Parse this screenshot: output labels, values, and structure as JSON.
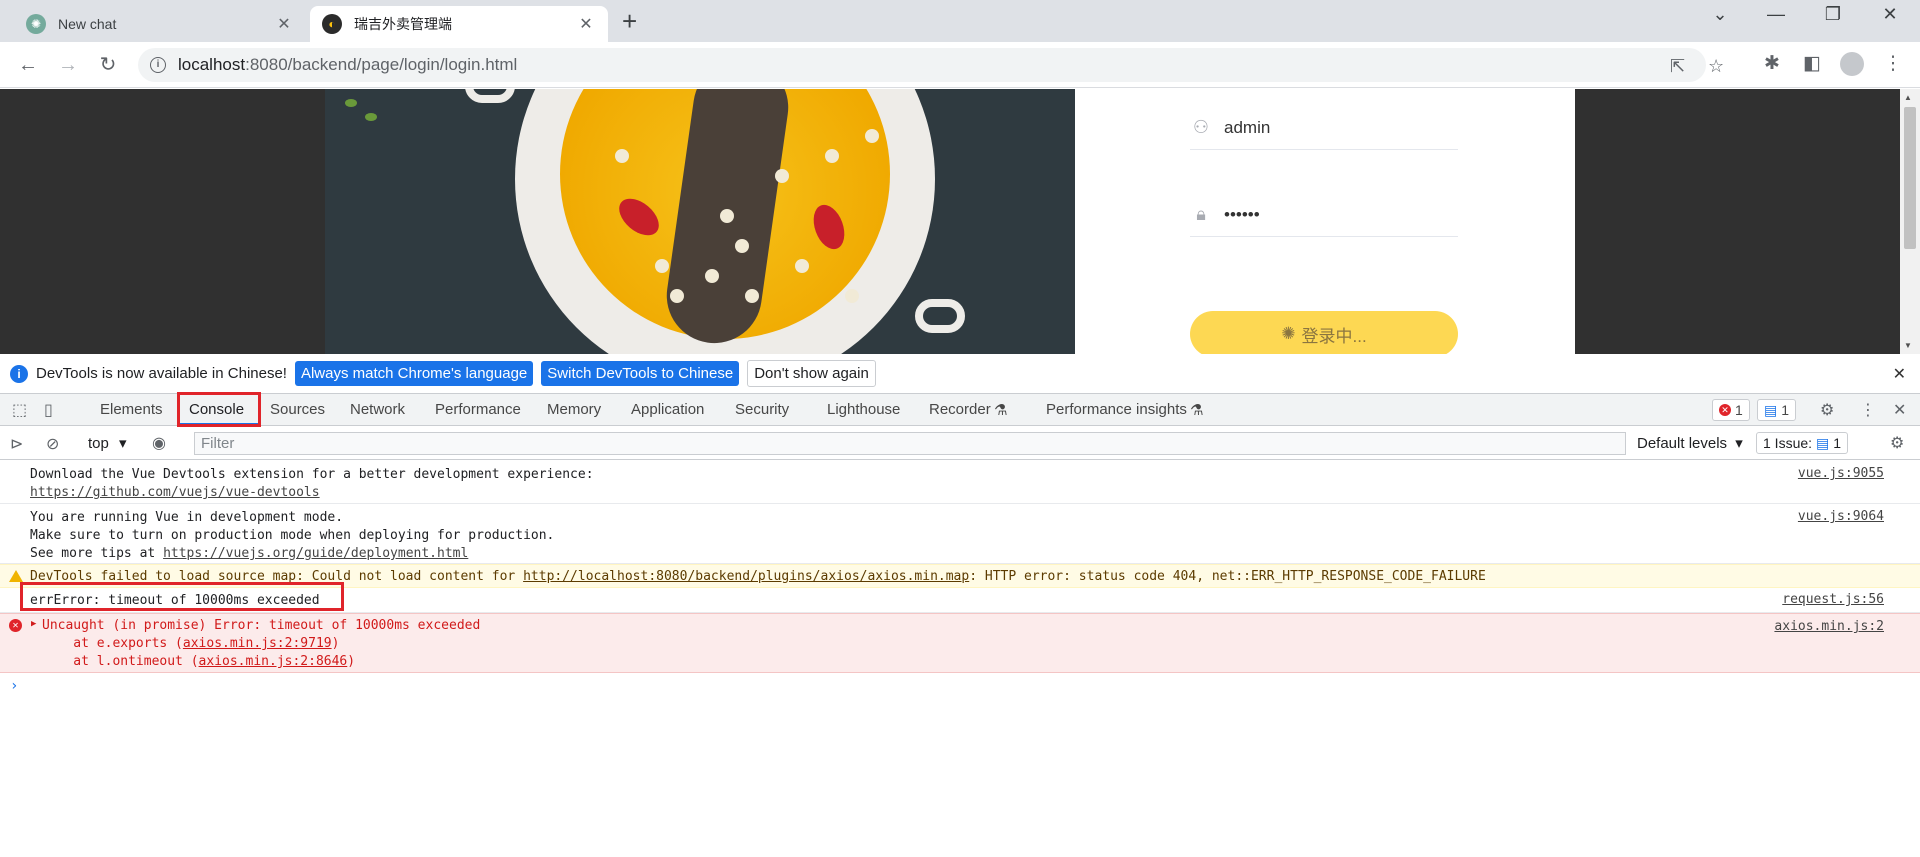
{
  "browser": {
    "tabs": [
      {
        "title": "New chat",
        "favicon": "chatgpt-icon"
      },
      {
        "title": "瑞吉外卖管理端",
        "favicon": "site-logo-icon"
      }
    ],
    "new_tab_symbol": "+",
    "url_host": "localhost",
    "url_path": ":8080/backend/page/login/login.html"
  },
  "login": {
    "username": "admin",
    "password": "••••••",
    "button_label": "登录中..."
  },
  "devtools": {
    "infobar": {
      "message": "DevTools is now available in Chinese!",
      "btn_match": "Always match Chrome's language",
      "btn_switch": "Switch DevTools to Chinese",
      "btn_dismiss": "Don't show again"
    },
    "tabs": [
      "Elements",
      "Console",
      "Sources",
      "Network",
      "Performance",
      "Memory",
      "Application",
      "Security",
      "Lighthouse",
      "Recorder",
      "Performance insights"
    ],
    "error_count": "1",
    "message_count": "1",
    "context": "top",
    "filter_placeholder": "Filter",
    "levels": "Default levels",
    "issues_label": "1 Issue:",
    "issues_count": "1"
  },
  "console": {
    "m1_line1": "Download the Vue Devtools extension for a better development experience:",
    "m1_link": "https://github.com/vuejs/vue-devtools",
    "m1_src": "vue.js:9055",
    "m2_line1": "You are running Vue in development mode.",
    "m2_line2": "Make sure to turn on production mode when deploying for production.",
    "m2_line3_prefix": "See more tips at ",
    "m2_link": "https://vuejs.org/guide/deployment.html",
    "m2_src": "vue.js:9064",
    "warn_prefix": "DevTools failed to load source map: Could not load content for ",
    "warn_link": "http://localhost:8080/backend/plugins/axios/axios.min.map",
    "warn_suffix": ": HTTP error: status code 404, net::ERR_HTTP_RESPONSE_CODE_FAILURE",
    "log_text": "errError: timeout of 10000ms exceeded",
    "log_src": "request.js:56",
    "err_line1": "Uncaught (in promise) Error: timeout of 10000ms exceeded",
    "err_line2_prefix": "    at e.exports (",
    "err_line2_link": "axios.min.js:2:9719",
    "err_line3_prefix": "    at l.ontimeout (",
    "err_line3_link": "axios.min.js:2:8646",
    "close_paren": ")",
    "err_src": "axios.min.js:2"
  }
}
